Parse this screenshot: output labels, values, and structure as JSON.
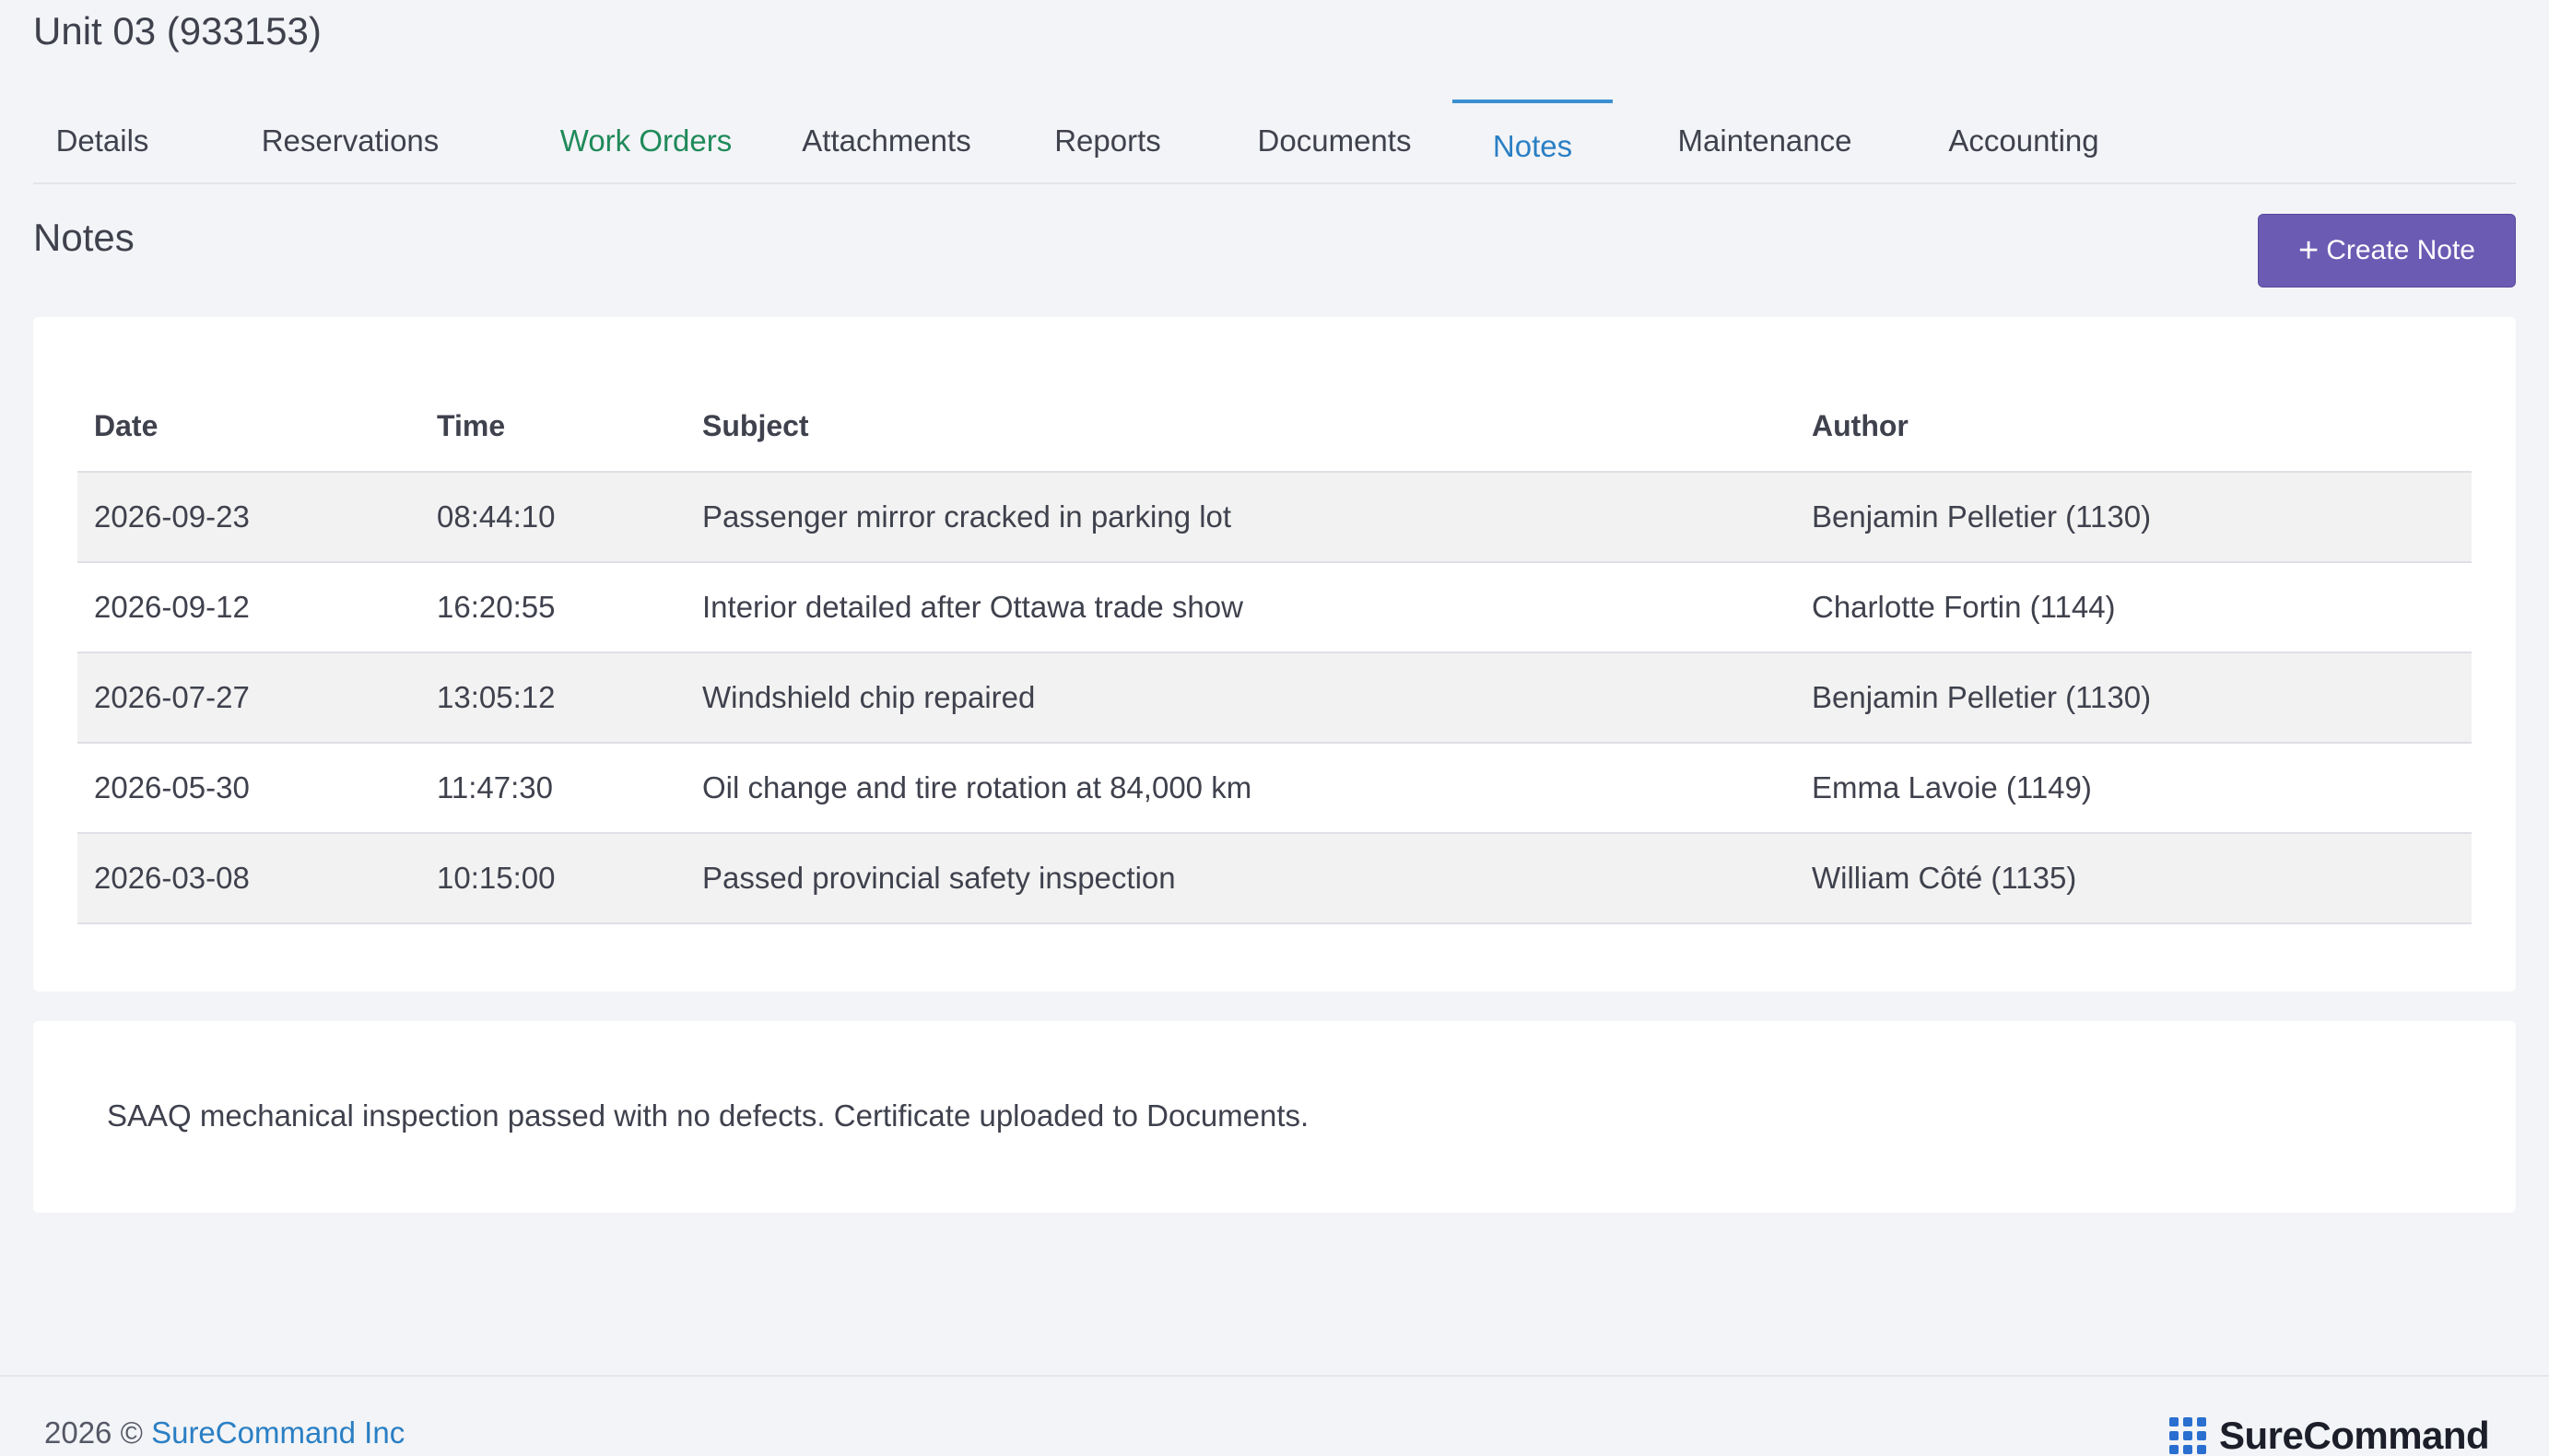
{
  "unit": {
    "title": "Unit 03 (933153)"
  },
  "tabs": [
    {
      "label": "Details"
    },
    {
      "label": "Reservations"
    },
    {
      "label": "Work Orders"
    },
    {
      "label": "Attachments"
    },
    {
      "label": "Reports"
    },
    {
      "label": "Documents"
    },
    {
      "label": "Notes"
    },
    {
      "label": "Maintenance"
    },
    {
      "label": "Accounting"
    }
  ],
  "active_tab": "Notes",
  "section": {
    "title": "Notes",
    "create_label": "Create Note",
    "create_icon": "plus-icon"
  },
  "table": {
    "headers": {
      "date": "Date",
      "time": "Time",
      "subject": "Subject",
      "author": "Author"
    },
    "rows": [
      {
        "date": "2026-09-23",
        "time": "08:44:10",
        "subject": "Passenger mirror cracked in parking lot",
        "author": "Benjamin Pelletier (1130)"
      },
      {
        "date": "2026-09-12",
        "time": "16:20:55",
        "subject": "Interior detailed after Ottawa trade show",
        "author": "Charlotte Fortin (1144)"
      },
      {
        "date": "2026-07-27",
        "time": "13:05:12",
        "subject": "Windshield chip repaired",
        "author": "Benjamin Pelletier (1130)"
      },
      {
        "date": "2026-05-30",
        "time": "11:47:30",
        "subject": "Oil change and tire rotation at 84,000 km",
        "author": "Emma Lavoie (1149)"
      },
      {
        "date": "2026-03-08",
        "time": "10:15:00",
        "subject": "Passed provincial safety inspection",
        "author": "William Côté (1135)"
      }
    ]
  },
  "note_detail": {
    "text": "SAAQ mechanical inspection passed with no defects. Certificate uploaded to Documents."
  },
  "footer": {
    "year_copy": "2026 ©",
    "company_link": "SureCommand Inc",
    "brand": "SureCommand",
    "brand_icon": "grid-logo-icon"
  },
  "colors": {
    "accent": "#6c5bb3",
    "link": "#2a7fc4",
    "work_orders": "#1f8a5a",
    "background": "#f3f4f7"
  }
}
